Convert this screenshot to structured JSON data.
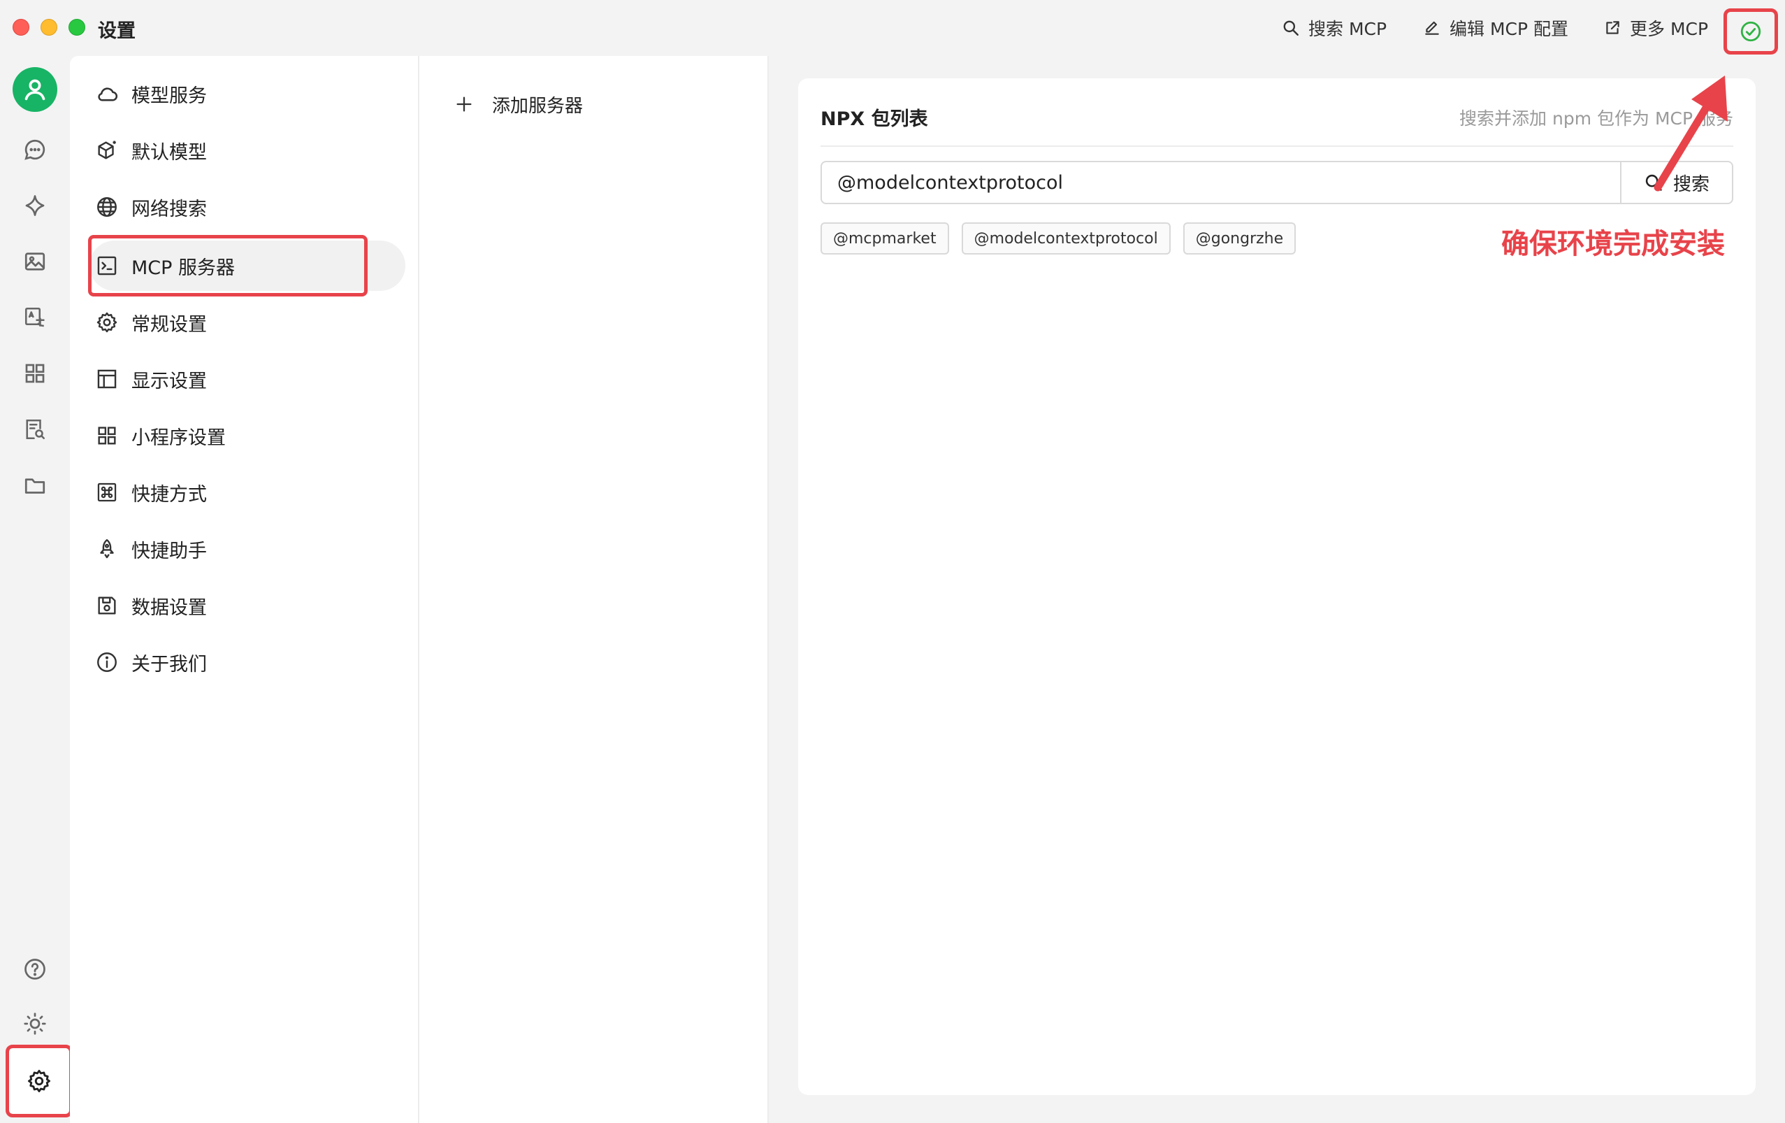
{
  "window": {
    "title": "设置"
  },
  "toolbar": {
    "search_mcp": "搜索 MCP",
    "edit_mcp": "编辑 MCP 配置",
    "more_mcp": "更多 MCP"
  },
  "nav": {
    "items": [
      {
        "label": "模型服务",
        "icon": "cloud-icon"
      },
      {
        "label": "默认模型",
        "icon": "cube-sparkle-icon"
      },
      {
        "label": "网络搜索",
        "icon": "globe-icon"
      },
      {
        "label": "MCP 服务器",
        "icon": "terminal-icon"
      },
      {
        "label": "常规设置",
        "icon": "gear-icon"
      },
      {
        "label": "显示设置",
        "icon": "layout-icon"
      },
      {
        "label": "小程序设置",
        "icon": "grid-icon"
      },
      {
        "label": "快捷方式",
        "icon": "command-icon"
      },
      {
        "label": "快捷助手",
        "icon": "rocket-icon"
      },
      {
        "label": "数据设置",
        "icon": "save-icon"
      },
      {
        "label": "关于我们",
        "icon": "info-icon"
      }
    ],
    "active_index": 3
  },
  "servers": {
    "add_label": "添加服务器"
  },
  "npx": {
    "title": "NPX 包列表",
    "hint": "搜索并添加 npm 包作为 MCP 服务",
    "search_value": "@modelcontextprotocol",
    "search_button": "搜索",
    "tags": [
      "@mcpmarket",
      "@modelcontextprotocol",
      "@gongrzhe"
    ]
  },
  "annotation": {
    "text": "确保环境完成安装"
  },
  "colors": {
    "accent_green": "#17b465",
    "annotation_red": "#e8434a",
    "status_ok": "#2fb344"
  }
}
